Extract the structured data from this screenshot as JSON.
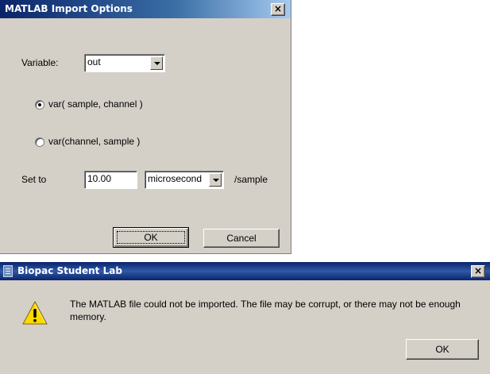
{
  "import_dialog": {
    "title": "MATLAB Import Options",
    "close_glyph": "×",
    "variable_label": "Variable:",
    "variable_value": "out",
    "radio_options": [
      {
        "label": "var( sample, channel )",
        "checked": true
      },
      {
        "label": "var(channel, sample )",
        "checked": false
      }
    ],
    "set_to_label": "Set to",
    "set_to_value": "10.00",
    "unit_value": "microsecond",
    "per_sample_label": "/sample",
    "ok_label": "OK",
    "cancel_label": "Cancel"
  },
  "error_dialog": {
    "title": "Biopac Student Lab",
    "close_glyph": "×",
    "icon": "warning-icon",
    "message": "The MATLAB file could not be imported.  The file may be corrupt, or there may not be enough memory.",
    "ok_label": "OK"
  },
  "colors": {
    "dialog_bg": "#d4d0c8",
    "titlebar_active": "#0a246a",
    "warning_yellow": "#ffd800"
  }
}
